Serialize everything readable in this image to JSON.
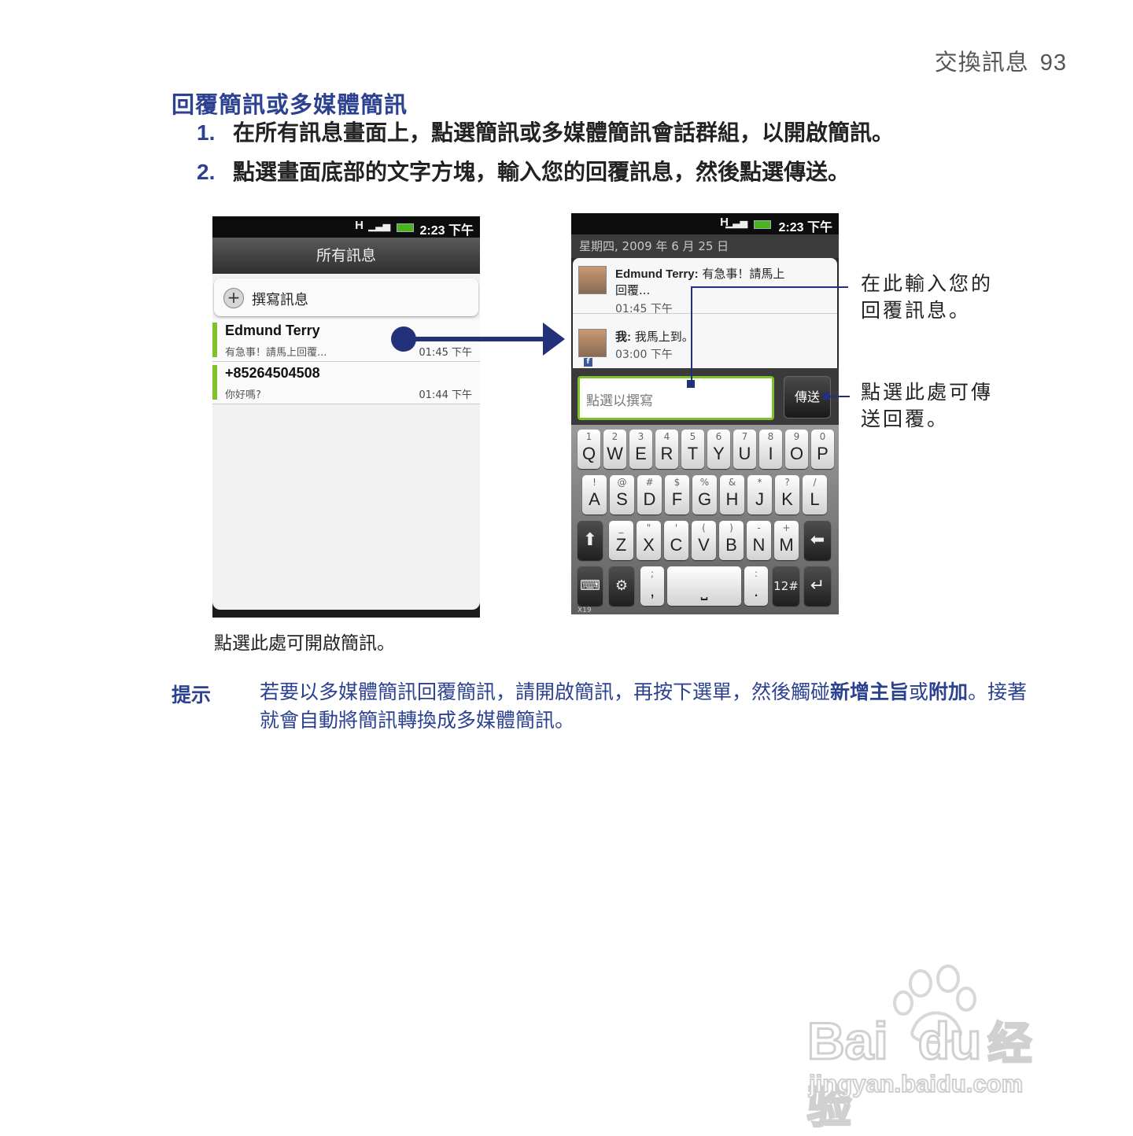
{
  "header": {
    "section": "交換訊息",
    "page": "93"
  },
  "title": "回覆簡訊或多媒體簡訊",
  "steps": [
    {
      "num": "1.",
      "text": "在所有訊息畫面上，點選簡訊或多媒體簡訊會話群組，以開啟簡訊。"
    },
    {
      "num": "2.",
      "text": "點選畫面底部的文字方塊，輸入您的回覆訊息，然後點選傳送。"
    }
  ],
  "phone1": {
    "status_time": "2:23 下午",
    "status_net": "H",
    "title": "所有訊息",
    "compose": "撰寫訊息",
    "threads": [
      {
        "name": "Edmund Terry",
        "preview": "有急事！請馬上回覆...",
        "time": "01:45 下午"
      },
      {
        "name": "+85264504508",
        "preview": "你好嗎?",
        "time": "01:44 下午"
      }
    ]
  },
  "caption1": "點選此處可開啟簡訊。",
  "phone2": {
    "status_time": "2:23 下午",
    "status_net": "H",
    "date": "星期四, 2009 年 6 月 25 日",
    "messages": [
      {
        "sender": "Edmund Terry:",
        "text": "有急事！請馬上",
        "text2": "回覆...",
        "time": "01:45 下午"
      },
      {
        "sender": "我:",
        "text": "我馬上到。",
        "text2": "",
        "time": "03:00 下午"
      }
    ],
    "input_placeholder": "點選以撰寫",
    "send_label": "傳送",
    "fb_glyph": "f",
    "keyboard": {
      "row1": [
        [
          "1",
          "Q"
        ],
        [
          "2",
          "W"
        ],
        [
          "3",
          "E"
        ],
        [
          "4",
          "R"
        ],
        [
          "5",
          "T"
        ],
        [
          "6",
          "Y"
        ],
        [
          "7",
          "U"
        ],
        [
          "8",
          "I"
        ],
        [
          "9",
          "O"
        ],
        [
          "0",
          "P"
        ]
      ],
      "row2": [
        [
          "!",
          "A"
        ],
        [
          "@",
          "S"
        ],
        [
          "#",
          "D"
        ],
        [
          "$",
          "F"
        ],
        [
          "%",
          "G"
        ],
        [
          "&",
          "H"
        ],
        [
          "*",
          "J"
        ],
        [
          "?",
          "K"
        ],
        [
          "/",
          "L"
        ]
      ],
      "row3": [
        [
          "_",
          "Z"
        ],
        [
          "\"",
          "X"
        ],
        [
          "'",
          "C"
        ],
        [
          "(",
          "V"
        ],
        [
          ")",
          "B"
        ],
        [
          "-",
          "N"
        ],
        [
          "+",
          "M"
        ]
      ],
      "shift": "⬆",
      "backspace": "⬅",
      "kb_icon": "⌨",
      "settings": "⚙",
      "semicolon": ";",
      "comma": ",",
      "space": "⎵",
      "colon": ":",
      "period": ".",
      "num_label": "12#",
      "enter": "↵",
      "footer": "X19"
    }
  },
  "annotations": {
    "input_line1": "在此輸入您的",
    "input_line2": "回覆訊息。",
    "send_line1": "點選此處可傳",
    "send_line2": "送回覆。"
  },
  "tip": {
    "label": "提示",
    "text_a": "若要以多媒體簡訊回覆簡訊，請開啟簡訊，再按下選單，然後觸碰",
    "bold_a": "新增主旨",
    "text_b": "或",
    "bold_b": "附加",
    "text_c": "。接著就會自動將簡訊轉換成多媒體簡訊。"
  },
  "watermark": {
    "brand": "Bai",
    "brand2": "du",
    "cn": "经验",
    "url": "jingyan.baidu.com"
  },
  "colors": {
    "accent": "#2c4291",
    "arrow": "#23317a",
    "thread_bar": "#7ec12b"
  }
}
